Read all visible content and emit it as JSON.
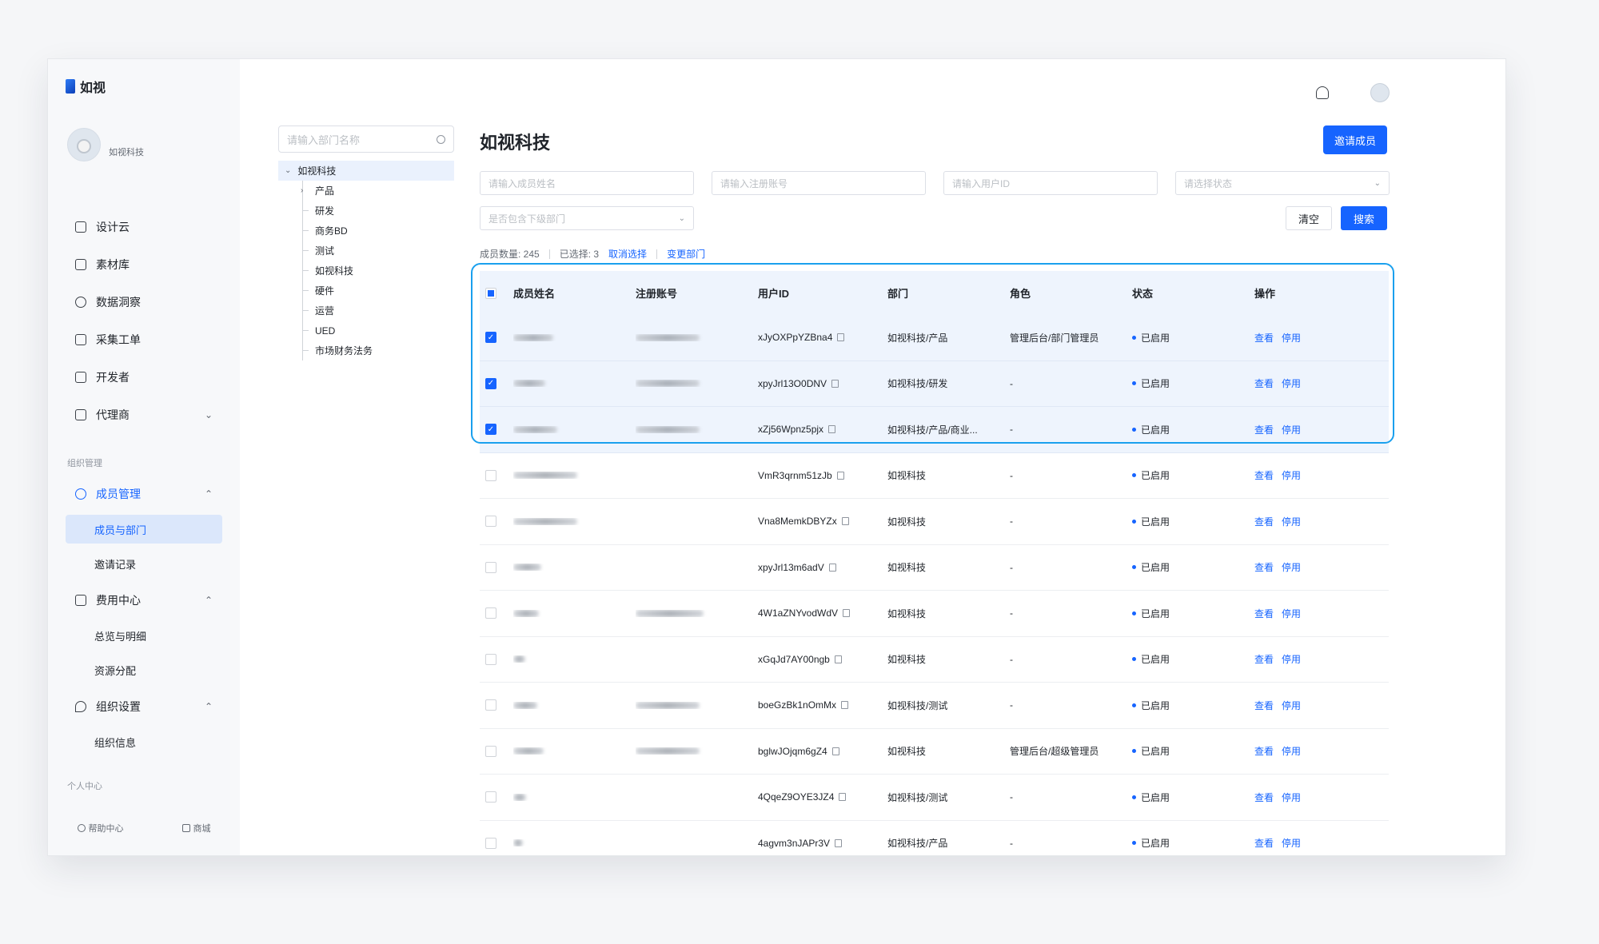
{
  "app": {
    "logo_text": "如视"
  },
  "profile": {
    "org_name": "如视科技"
  },
  "nav": {
    "items": [
      {
        "label": "设计云"
      },
      {
        "label": "素材库"
      },
      {
        "label": "数据洞察"
      },
      {
        "label": "采集工单"
      },
      {
        "label": "开发者"
      },
      {
        "label": "代理商"
      }
    ],
    "group_org": "组织管理",
    "member_mgmt": "成员管理",
    "member_sub": [
      "成员与部门",
      "邀请记录"
    ],
    "fee_center": "费用中心",
    "fee_sub": [
      "总览与明细",
      "资源分配"
    ],
    "org_settings": "组织设置",
    "org_sub": [
      "组织信息"
    ],
    "group_personal": "个人中心",
    "footer": {
      "help": "帮助中心",
      "shop": "商城"
    }
  },
  "tree": {
    "search_placeholder": "请输入部门名称",
    "root": "如视科技",
    "children": [
      "产品",
      "研发",
      "商务BD",
      "测试",
      "如视科技",
      "硬件",
      "运营",
      "UED",
      "市场财务法务"
    ]
  },
  "main": {
    "title": "如视科技",
    "invite_label": "邀请成员",
    "filters": {
      "name_placeholder": "请输入成员姓名",
      "account_placeholder": "请输入注册账号",
      "uid_placeholder": "请输入用户ID",
      "status_placeholder": "请选择状态",
      "subdept_placeholder": "是否包含下级部门"
    },
    "clear_label": "清空",
    "search_label": "搜索",
    "stats": {
      "member_count": "成员数量: 245",
      "selected": "已选择: 3",
      "cancel_select": "取消选择",
      "change_dept": "变更部门"
    }
  },
  "table": {
    "headers": [
      "成员姓名",
      "注册账号",
      "用户ID",
      "部门",
      "角色",
      "状态",
      "操作"
    ],
    "op_view": "查看",
    "op_disable": "停用",
    "rows": [
      {
        "uid": "xJyOXPpYZBna4",
        "dept": "如视科技/产品",
        "role": "管理后台/部门管理员",
        "status": "已启用",
        "checked": true,
        "name_w": 50,
        "acct_w": 80
      },
      {
        "uid": "xpyJrl13O0DNV",
        "dept": "如视科技/研发",
        "role": "-",
        "status": "已启用",
        "checked": true,
        "name_w": 40,
        "acct_w": 80
      },
      {
        "uid": "xZj56Wpnz5pjx",
        "dept": "如视科技/产品/商业...",
        "role": "-",
        "status": "已启用",
        "checked": true,
        "name_w": 55,
        "acct_w": 80
      },
      {
        "uid": "VmR3qrnm51zJb",
        "dept": "如视科技",
        "role": "-",
        "status": "已启用",
        "checked": false,
        "name_w": 80,
        "acct_w": 0
      },
      {
        "uid": "Vna8MemkDBYZx",
        "dept": "如视科技",
        "role": "-",
        "status": "已启用",
        "checked": false,
        "name_w": 80,
        "acct_w": 0
      },
      {
        "uid": "xpyJrl13m6adV",
        "dept": "如视科技",
        "role": "-",
        "status": "已启用",
        "checked": false,
        "name_w": 35,
        "acct_w": 0
      },
      {
        "uid": "4W1aZNYvodWdV",
        "dept": "如视科技",
        "role": "-",
        "status": "已启用",
        "checked": false,
        "name_w": 32,
        "acct_w": 85
      },
      {
        "uid": "xGqJd7AY00ngb",
        "dept": "如视科技",
        "role": "-",
        "status": "已启用",
        "checked": false,
        "name_w": 15,
        "acct_w": 0
      },
      {
        "uid": "boeGzBk1nOmMx",
        "dept": "如视科技/测试",
        "role": "-",
        "status": "已启用",
        "checked": false,
        "name_w": 30,
        "acct_w": 80
      },
      {
        "uid": "bglwJOjqm6gZ4",
        "dept": "如视科技",
        "role": "管理后台/超级管理员",
        "status": "已启用",
        "checked": false,
        "name_w": 38,
        "acct_w": 80
      },
      {
        "uid": "4QqeZ9OYE3JZ4",
        "dept": "如视科技/测试",
        "role": "-",
        "status": "已启用",
        "checked": false,
        "name_w": 16,
        "acct_w": 0
      },
      {
        "uid": "4agvm3nJAPr3V",
        "dept": "如视科技/产品",
        "role": "-",
        "status": "已启用",
        "checked": false,
        "name_w": 12,
        "acct_w": 0
      }
    ]
  },
  "colors": {
    "accent": "#1664ff",
    "highlight_frame": "#1aa0ee",
    "selected_row": "#eef4fd"
  }
}
